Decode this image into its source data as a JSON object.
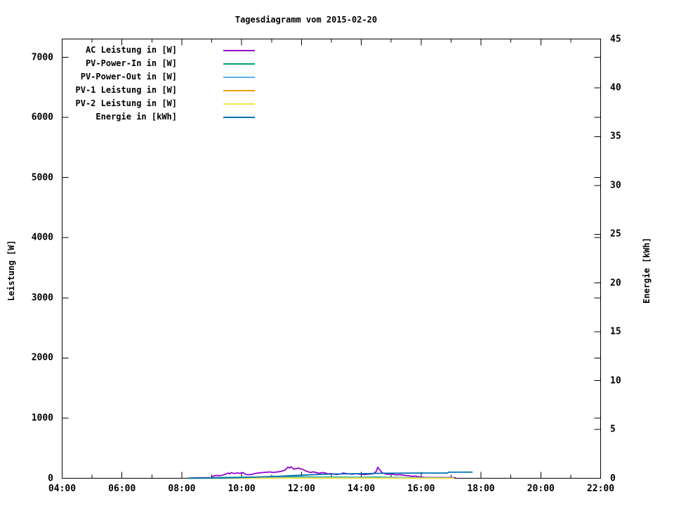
{
  "background_color": "#ffffff",
  "frame_color": "#000000",
  "chart_data": {
    "type": "line",
    "title": "Tagesdiagramm vom 2015-02-20",
    "grid": false,
    "legend_position": "top-left-inside",
    "x_axis": {
      "unit": "time",
      "range_hours": [
        4,
        22
      ],
      "major_ticks": [
        {
          "h": 4,
          "label": "04:00"
        },
        {
          "h": 6,
          "label": "06:00"
        },
        {
          "h": 8,
          "label": "08:00"
        },
        {
          "h": 10,
          "label": "10:00"
        },
        {
          "h": 12,
          "label": "12:00"
        },
        {
          "h": 14,
          "label": "14:00"
        },
        {
          "h": 16,
          "label": "16:00"
        },
        {
          "h": 18,
          "label": "18:00"
        },
        {
          "h": 20,
          "label": "20:00"
        },
        {
          "h": 22,
          "label": "22:00"
        }
      ],
      "minor_tick_hours": [
        5,
        7,
        9,
        11,
        13,
        15,
        17,
        19,
        21
      ]
    },
    "y_left": {
      "label": "Leistung [W]",
      "range": [
        0,
        7300
      ],
      "ticks": [
        {
          "v": 0,
          "label": "0"
        },
        {
          "v": 1000,
          "label": "1000"
        },
        {
          "v": 2000,
          "label": "2000"
        },
        {
          "v": 3000,
          "label": "3000"
        },
        {
          "v": 4000,
          "label": "4000"
        },
        {
          "v": 5000,
          "label": "5000"
        },
        {
          "v": 6000,
          "label": "6000"
        },
        {
          "v": 7000,
          "label": "7000"
        }
      ]
    },
    "y_right": {
      "label": "Energie [kWh]",
      "range": [
        0,
        45
      ],
      "ticks": [
        {
          "v": 0,
          "label": "0"
        },
        {
          "v": 5,
          "label": "5"
        },
        {
          "v": 10,
          "label": "10"
        },
        {
          "v": 15,
          "label": "15"
        },
        {
          "v": 20,
          "label": "20"
        },
        {
          "v": 25,
          "label": "25"
        },
        {
          "v": 30,
          "label": "30"
        },
        {
          "v": 35,
          "label": "35"
        },
        {
          "v": 40,
          "label": "40"
        },
        {
          "v": 45,
          "label": "45"
        }
      ]
    },
    "series": [
      {
        "id": "ac-leistung",
        "name": "AC Leistung in [W]",
        "color": "#9400d3",
        "axis": "left",
        "points": [
          [
            8.25,
            5
          ],
          [
            8.35,
            6
          ],
          [
            8.5,
            8
          ],
          [
            8.7,
            9
          ],
          [
            8.9,
            10
          ],
          [
            9.0,
            12
          ],
          [
            9.05,
            38
          ],
          [
            9.15,
            45
          ],
          [
            9.25,
            42
          ],
          [
            9.35,
            50
          ],
          [
            9.45,
            65
          ],
          [
            9.55,
            88
          ],
          [
            9.6,
            72
          ],
          [
            9.65,
            95
          ],
          [
            9.75,
            78
          ],
          [
            9.85,
            88
          ],
          [
            9.95,
            82
          ],
          [
            10.05,
            92
          ],
          [
            10.15,
            62
          ],
          [
            10.25,
            58
          ],
          [
            10.35,
            66
          ],
          [
            10.45,
            80
          ],
          [
            10.55,
            88
          ],
          [
            10.65,
            92
          ],
          [
            10.75,
            96
          ],
          [
            10.85,
            100
          ],
          [
            10.95,
            105
          ],
          [
            11.05,
            96
          ],
          [
            11.15,
            102
          ],
          [
            11.25,
            108
          ],
          [
            11.35,
            118
          ],
          [
            11.45,
            135
          ],
          [
            11.5,
            160
          ],
          [
            11.55,
            188
          ],
          [
            11.6,
            168
          ],
          [
            11.65,
            192
          ],
          [
            11.7,
            170
          ],
          [
            11.75,
            152
          ],
          [
            11.85,
            162
          ],
          [
            11.9,
            172
          ],
          [
            11.95,
            158
          ],
          [
            12.05,
            148
          ],
          [
            12.1,
            132
          ],
          [
            12.2,
            112
          ],
          [
            12.3,
            96
          ],
          [
            12.4,
            106
          ],
          [
            12.5,
            92
          ],
          [
            12.6,
            82
          ],
          [
            12.7,
            96
          ],
          [
            12.8,
            86
          ],
          [
            12.9,
            72
          ],
          [
            13.0,
            78
          ],
          [
            13.1,
            66
          ],
          [
            13.2,
            62
          ],
          [
            13.3,
            72
          ],
          [
            13.4,
            86
          ],
          [
            13.5,
            80
          ],
          [
            13.6,
            72
          ],
          [
            13.7,
            66
          ],
          [
            13.8,
            76
          ],
          [
            13.9,
            70
          ],
          [
            14.0,
            66
          ],
          [
            14.1,
            62
          ],
          [
            14.2,
            66
          ],
          [
            14.3,
            70
          ],
          [
            14.4,
            76
          ],
          [
            14.5,
            112
          ],
          [
            14.55,
            182
          ],
          [
            14.6,
            148
          ],
          [
            14.7,
            92
          ],
          [
            14.8,
            72
          ],
          [
            14.9,
            66
          ],
          [
            15.0,
            70
          ],
          [
            15.1,
            62
          ],
          [
            15.2,
            56
          ],
          [
            15.3,
            60
          ],
          [
            15.4,
            52
          ],
          [
            15.5,
            46
          ],
          [
            15.6,
            40
          ],
          [
            15.7,
            32
          ],
          [
            15.8,
            36
          ],
          [
            15.9,
            26
          ],
          [
            16.0,
            20
          ],
          [
            16.1,
            14
          ],
          [
            16.2,
            12
          ],
          [
            16.5,
            12
          ],
          [
            16.8,
            12
          ],
          [
            17.0,
            12
          ],
          [
            17.15,
            10
          ]
        ]
      },
      {
        "id": "pv-power-in",
        "name": "PV-Power-In in [W]",
        "color": "#009e73",
        "axis": "left",
        "points": [
          [
            8.2,
            2
          ],
          [
            8.6,
            5
          ],
          [
            9.0,
            9
          ],
          [
            9.5,
            13
          ],
          [
            10.0,
            16
          ],
          [
            10.5,
            19
          ],
          [
            11.0,
            21
          ],
          [
            11.5,
            26
          ],
          [
            11.7,
            28
          ],
          [
            12.0,
            24
          ],
          [
            12.5,
            21
          ],
          [
            13.0,
            19
          ],
          [
            13.5,
            17
          ],
          [
            14.0,
            16
          ],
          [
            14.5,
            20
          ],
          [
            15.0,
            15
          ],
          [
            15.5,
            11
          ],
          [
            16.0,
            8
          ],
          [
            16.5,
            6
          ],
          [
            17.1,
            5
          ]
        ]
      },
      {
        "id": "pv-power-out",
        "name": "PV-Power-Out in [W]",
        "color": "#56b4e9",
        "axis": "left",
        "points": [
          [
            9.4,
            6
          ],
          [
            10.0,
            9
          ],
          [
            10.5,
            11
          ],
          [
            11.0,
            13
          ],
          [
            11.5,
            15
          ],
          [
            12.0,
            14
          ],
          [
            12.5,
            13
          ],
          [
            13.0,
            12
          ],
          [
            13.5,
            11
          ],
          [
            14.0,
            10
          ],
          [
            14.5,
            12
          ],
          [
            15.0,
            9
          ],
          [
            15.5,
            7
          ],
          [
            16.0,
            5
          ],
          [
            16.5,
            4
          ],
          [
            17.1,
            3
          ]
        ]
      },
      {
        "id": "pv1-leistung",
        "name": "PV-1 Leistung in [W]",
        "color": "#e69f00",
        "axis": "left",
        "points": [
          [
            8.2,
            1
          ],
          [
            10.0,
            2
          ],
          [
            12.0,
            3
          ],
          [
            14.0,
            2
          ],
          [
            16.0,
            1
          ],
          [
            17.1,
            1
          ]
        ]
      },
      {
        "id": "pv2-leistung",
        "name": "PV-2 Leistung in [W]",
        "color": "#f0e442",
        "axis": "left",
        "points": [
          [
            8.2,
            1
          ],
          [
            10.0,
            1
          ],
          [
            12.0,
            2
          ],
          [
            14.0,
            1
          ],
          [
            17.1,
            1
          ]
        ]
      },
      {
        "id": "energie",
        "name": "Energie in [kWh]",
        "color": "#0072b2",
        "axis": "right",
        "points": [
          [
            8.2,
            0
          ],
          [
            8.8,
            0.01
          ],
          [
            9.3,
            0.02
          ],
          [
            9.8,
            0.05
          ],
          [
            10.3,
            0.1
          ],
          [
            10.8,
            0.15
          ],
          [
            11.3,
            0.21
          ],
          [
            11.8,
            0.29
          ],
          [
            12.3,
            0.36
          ],
          [
            12.8,
            0.41
          ],
          [
            13.3,
            0.44
          ],
          [
            13.8,
            0.47
          ],
          [
            14.3,
            0.49
          ],
          [
            14.8,
            0.51
          ],
          [
            15.3,
            0.52
          ],
          [
            15.8,
            0.53
          ],
          [
            16.3,
            0.53
          ],
          [
            16.88,
            0.53
          ],
          [
            16.92,
            0.62
          ],
          [
            17.15,
            0.62
          ],
          [
            17.72,
            0.63
          ]
        ]
      }
    ]
  }
}
